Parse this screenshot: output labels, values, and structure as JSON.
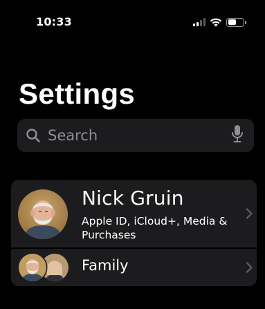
{
  "status_bar": {
    "time": "10:33",
    "icons": [
      "signal-icon",
      "wifi-icon",
      "battery-icon"
    ]
  },
  "header": {
    "title": "Settings"
  },
  "search": {
    "placeholder": "Search",
    "icons": [
      "search-icon",
      "microphone-icon"
    ]
  },
  "profile": {
    "name": "Nick Gruin",
    "subtitle": "Apple ID, iCloud+, Media & Purchases",
    "icons": [
      "avatar",
      "chevron-right-icon"
    ]
  },
  "family": {
    "label": "Family",
    "icons": [
      "family-avatars",
      "chevron-right-icon"
    ]
  },
  "colors": {
    "background": "#000000",
    "cell": "#1c1c1e",
    "secondary_text": "#8e8e93",
    "chevron": "#5a5a5f"
  }
}
